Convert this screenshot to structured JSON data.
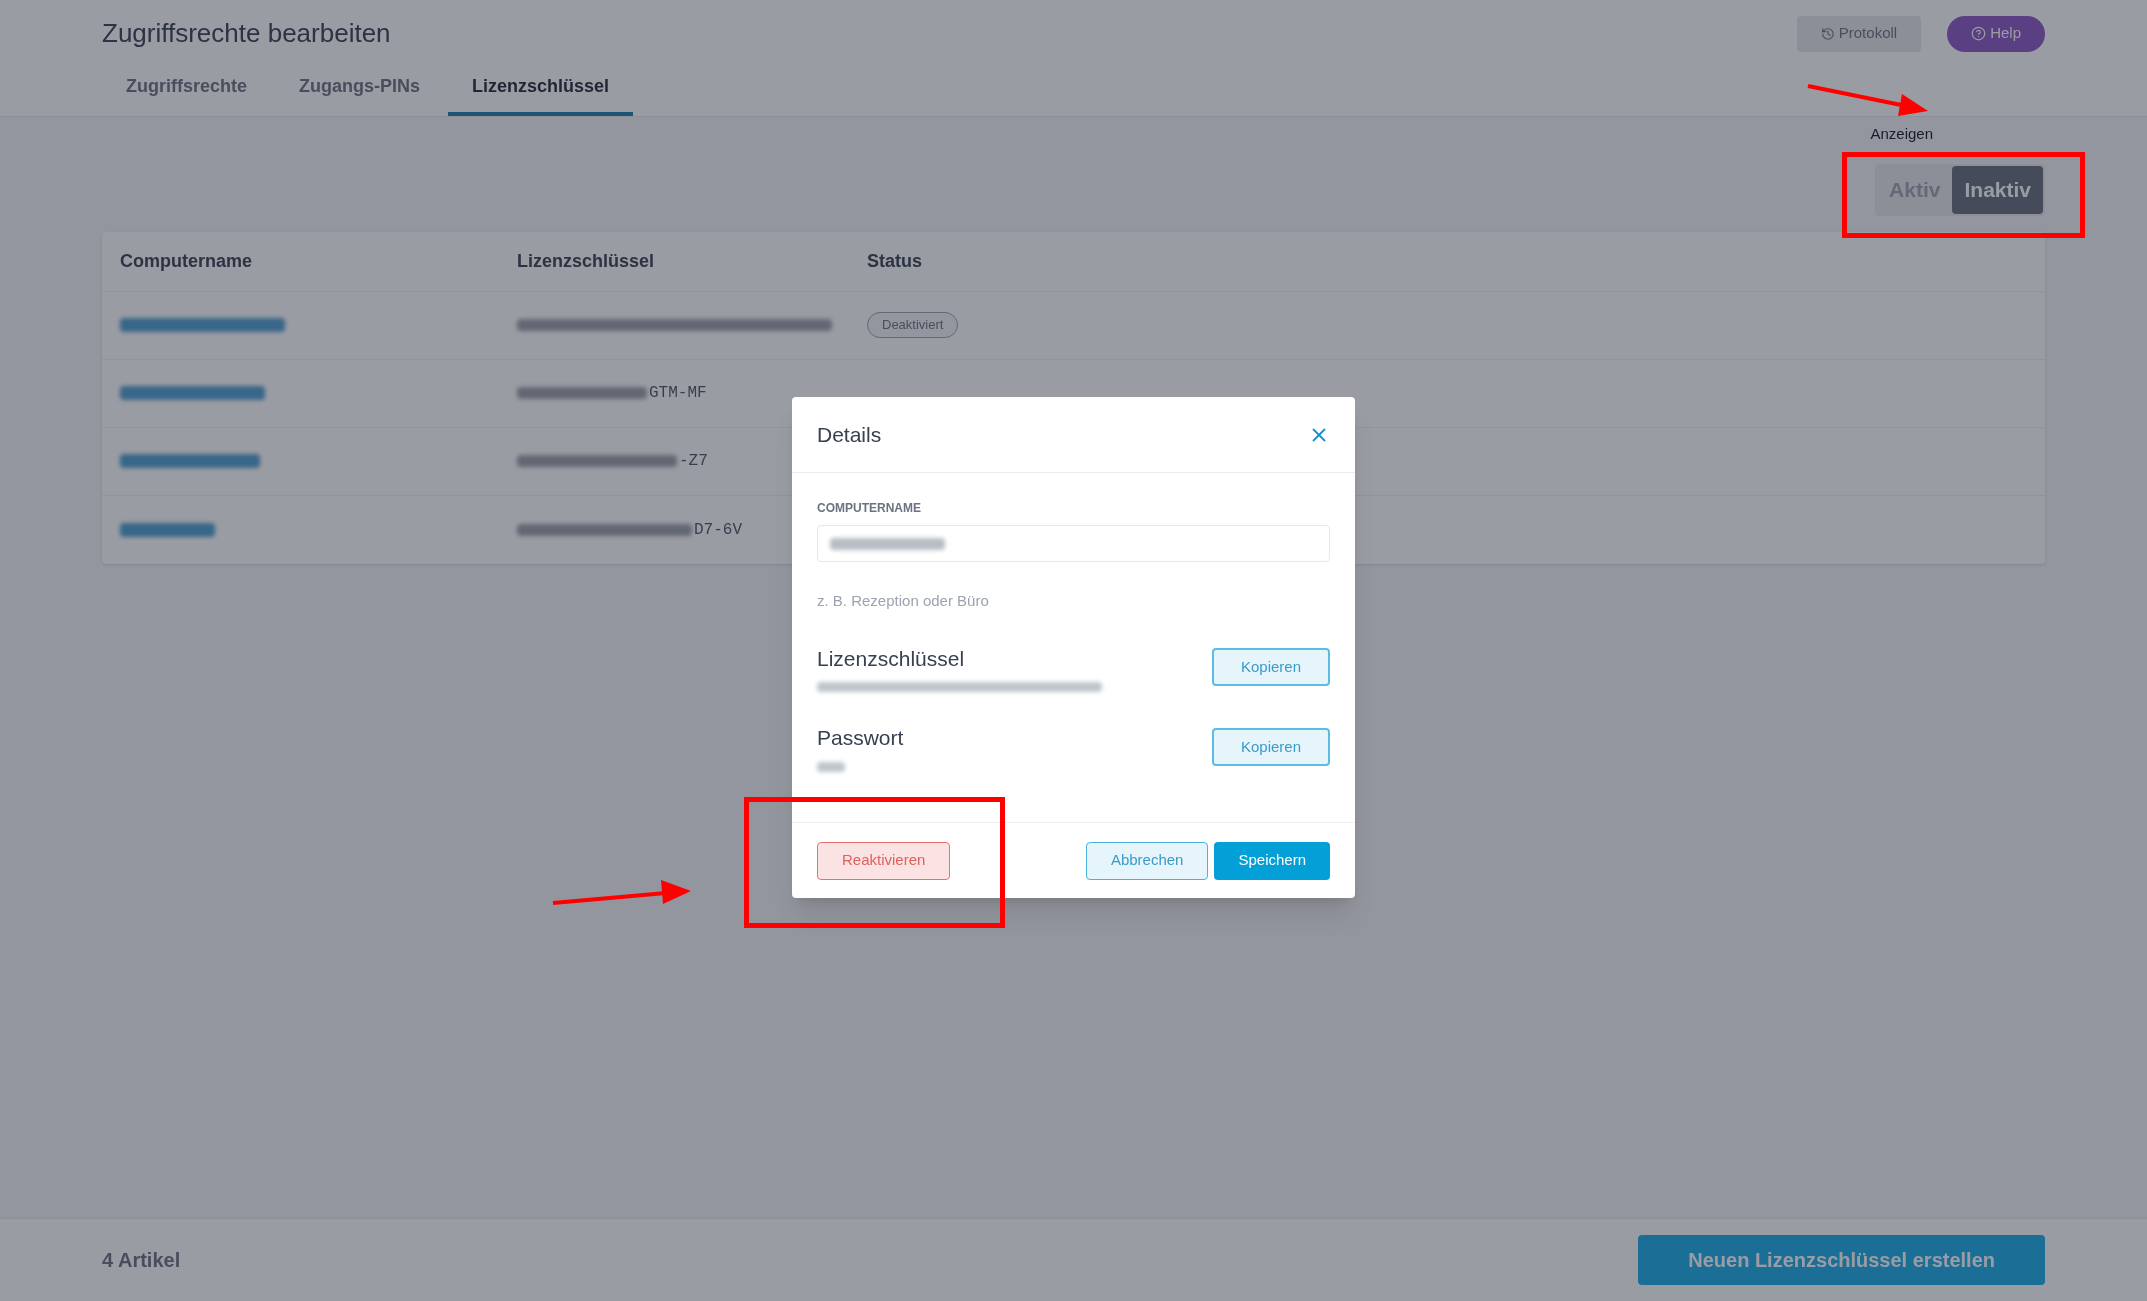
{
  "header": {
    "title": "Zugriffsrechte bearbeiten",
    "buttons": [
      {
        "kind": "protokoll",
        "label": "Protokoll"
      },
      {
        "kind": "help",
        "label": "Help"
      }
    ]
  },
  "tabs": [
    {
      "label": "Zugriffsrechte",
      "selected": false
    },
    {
      "label": "Zugangs-PINs",
      "selected": false
    },
    {
      "label": "Lizenzschlüssel",
      "selected": true
    }
  ],
  "filter": {
    "label": "Anzeigen",
    "options": [
      {
        "label": "Aktiv",
        "selected": false
      },
      {
        "label": "Inaktiv",
        "selected": true
      }
    ]
  },
  "table": {
    "columns": [
      "Computername",
      "Lizenzschlüssel",
      "Status"
    ],
    "rows": [
      {
        "status": "Deaktiviert"
      },
      {
        "key_tail": "GTM-MF"
      },
      {
        "key_tail": "-Z7"
      },
      {
        "key_tail": "D7-6V"
      }
    ]
  },
  "modal": {
    "title": "Details",
    "field": {
      "label": "COMPUTERNAME",
      "hint": "z. B. Rezeption oder Büro"
    },
    "secrets": [
      {
        "label": "Lizenzschlüssel",
        "button": "Kopieren"
      },
      {
        "label": "Passwort",
        "button": "Kopieren"
      }
    ],
    "actions": [
      {
        "kind": "danger",
        "label": "Reaktivieren"
      },
      {
        "kind": "secondary",
        "label": "Abbrechen"
      },
      {
        "kind": "primary",
        "label": "Speichern"
      }
    ]
  },
  "footer": {
    "count": "4 Artikel",
    "button": "Neuen Lizenzschlüssel erstellen"
  }
}
